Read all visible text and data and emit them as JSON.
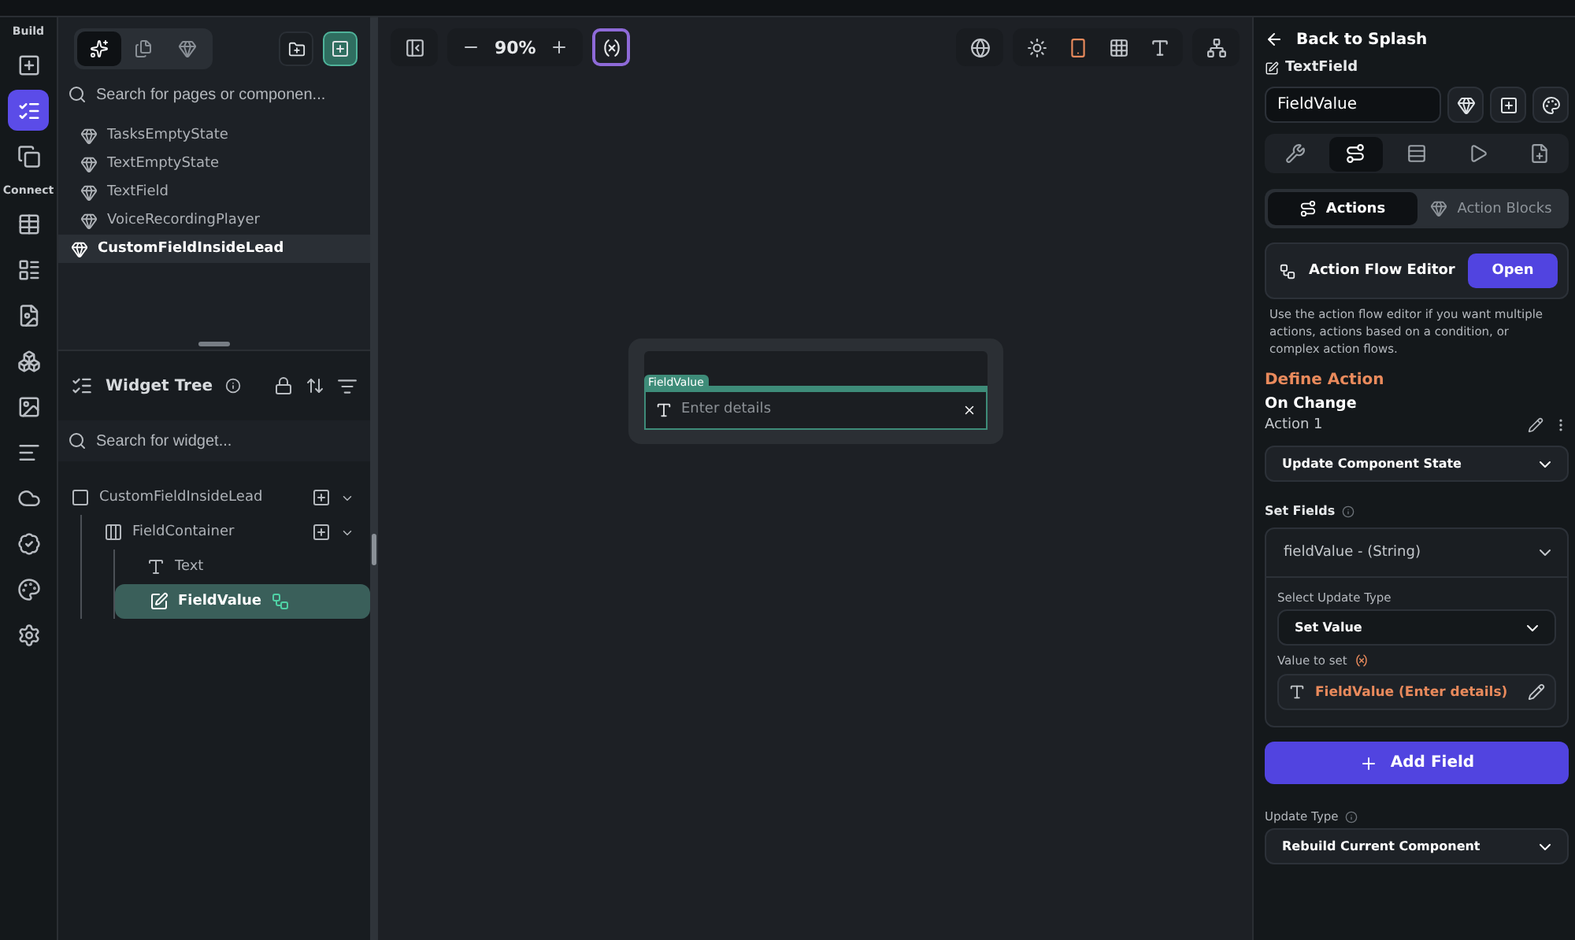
{
  "rail": {
    "groups": [
      {
        "label": "Build",
        "items": [
          {
            "selected": false
          },
          {
            "selected": true
          },
          {
            "selected": false
          }
        ]
      },
      {
        "label": "Connect",
        "items": [
          {
            "selected": false
          },
          {
            "selected": false
          },
          {
            "selected": false
          },
          {
            "selected": false
          },
          {
            "selected": false
          },
          {
            "selected": false
          },
          {
            "selected": false
          },
          {
            "selected": false
          },
          {
            "selected": false
          },
          {
            "selected": false
          }
        ]
      }
    ]
  },
  "pages_panel": {
    "tabs": [
      {
        "selected": true
      },
      {
        "selected": false
      },
      {
        "selected": false
      }
    ],
    "search": {
      "placeholder": "Search for pages or componen..."
    },
    "items": [
      {
        "label": "TasksEmptyState",
        "selected": false
      },
      {
        "label": "TextEmptyState",
        "selected": false
      },
      {
        "label": "TextField",
        "selected": false
      },
      {
        "label": "VoiceRecordingPlayer",
        "selected": false
      },
      {
        "label": "CustomFieldInsideLead",
        "selected": true
      }
    ]
  },
  "widget_tree": {
    "title": "Widget Tree",
    "search": {
      "placeholder": "Search for widget..."
    },
    "nodes": [
      {
        "label": "CustomFieldInsideLead",
        "kind": "component",
        "selected": false,
        "has_actions": false,
        "children": [
          {
            "label": "FieldContainer",
            "kind": "column",
            "selected": false,
            "has_actions": false,
            "children": [
              {
                "label": "Text",
                "kind": "text",
                "selected": false,
                "has_actions": false
              },
              {
                "label": "FieldValue",
                "kind": "textfield",
                "selected": true,
                "has_actions": true
              }
            ]
          }
        ]
      }
    ]
  },
  "toolbar": {
    "zoom": "90%"
  },
  "canvas": {
    "widget_label": "FieldValue",
    "placeholder": "Enter details"
  },
  "properties": {
    "back": "Back to Splash",
    "widget_type": "TextField",
    "name": {
      "value": "FieldValue"
    },
    "tabs": [
      {
        "selected": false
      },
      {
        "selected": true
      },
      {
        "selected": false
      },
      {
        "selected": false
      },
      {
        "selected": false
      }
    ],
    "action_tabs": [
      {
        "label": "Actions",
        "selected": true
      },
      {
        "label": "Action Blocks",
        "selected": false
      }
    ],
    "flow_editor": {
      "title": "Action Flow Editor",
      "button": "Open",
      "help": "Use the action flow editor if you want multiple actions, actions based on a condition, or complex action flows."
    },
    "define_action": "Define Action",
    "trigger": "On Change",
    "action_name": "Action 1",
    "action_type": "Update Component State",
    "set_fields": {
      "label": "Set Fields",
      "field": "fieldValue - (String)",
      "select_label": "Select Update Type",
      "update_value": "Set Value",
      "value_label": "Value to set",
      "value": "FieldValue (Enter details)"
    },
    "add_field": "Add Field",
    "update_type": {
      "label": "Update Type",
      "value": "Rebuild Current Component"
    }
  }
}
